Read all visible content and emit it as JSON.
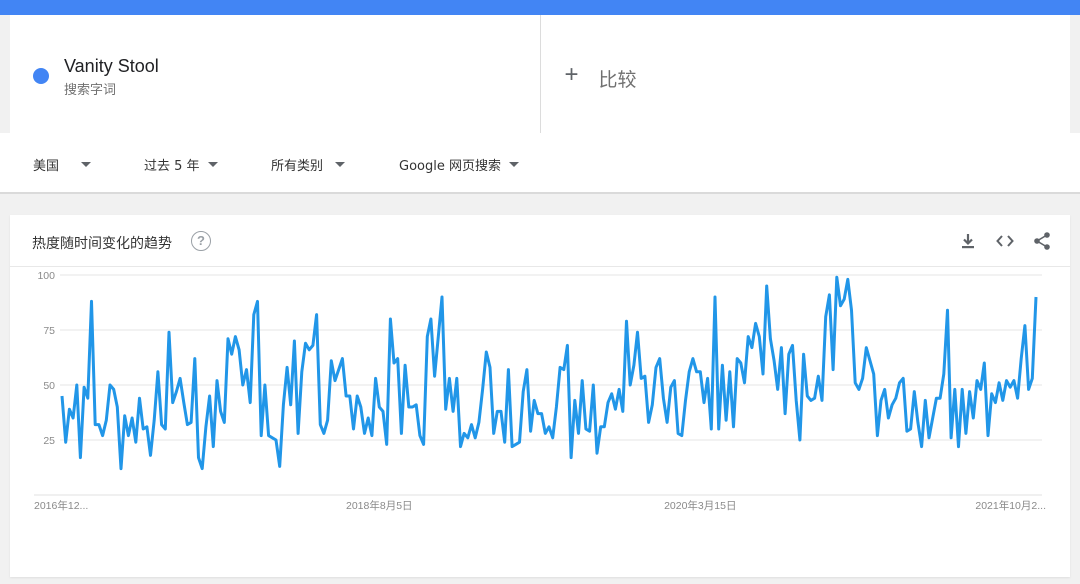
{
  "colors": {
    "accent": "#4285f4",
    "series": "#2196e8"
  },
  "term": {
    "name": "Vanity Stool",
    "sub": "搜索字词",
    "dot_icon": "circle-dot"
  },
  "compare": {
    "label": "比较",
    "icon": "plus-icon"
  },
  "filters": [
    {
      "label": "美国"
    },
    {
      "label": "过去 5 年"
    },
    {
      "label": "所有类别"
    },
    {
      "label": "Google 网页搜索"
    }
  ],
  "chart_header": {
    "title": "热度随时间变化的趋势",
    "help": "?",
    "icons": [
      "download-icon",
      "embed-code-icon",
      "share-icon"
    ]
  },
  "chart_data": {
    "type": "line",
    "title": "",
    "xlabel": "",
    "ylabel": "",
    "ylim": [
      0,
      100
    ],
    "yticks": [
      25,
      50,
      75,
      100
    ],
    "grid": true,
    "x_tick_labels": [
      "2016年12...",
      "2018年8月5日",
      "2020年3月15日",
      "2021年10月2..."
    ],
    "x_tick_index": [
      0,
      86,
      173,
      263
    ],
    "partial_from_index": 265,
    "series": [
      {
        "values": [
          45,
          24,
          39,
          35,
          50,
          17,
          49,
          44,
          88,
          32,
          32,
          27,
          34,
          50,
          48,
          40,
          12,
          36,
          27,
          35,
          24,
          44,
          30,
          31,
          18,
          34,
          56,
          32,
          30,
          74,
          42,
          47,
          53,
          42,
          32,
          33,
          62,
          17,
          12,
          31,
          45,
          22,
          52,
          38,
          33,
          71,
          64,
          72,
          66,
          50,
          57,
          42,
          82,
          88,
          27,
          50,
          27,
          26,
          25,
          13,
          41,
          58,
          41,
          70,
          28,
          56,
          69,
          66,
          68,
          82,
          32,
          28,
          34,
          61,
          52,
          57,
          62,
          45,
          45,
          30,
          45,
          40,
          28,
          35,
          27,
          53,
          40,
          38,
          23,
          80,
          60,
          62,
          28,
          59,
          40,
          40,
          41,
          27,
          23,
          72,
          80,
          54,
          72,
          90,
          39,
          53,
          38,
          53,
          22,
          28,
          26,
          32,
          26,
          33,
          48,
          65,
          58,
          28,
          38,
          38,
          24,
          57,
          22,
          23,
          24,
          47,
          57,
          29,
          43,
          37,
          37,
          28,
          31,
          26,
          40,
          58,
          57,
          68,
          17,
          43,
          28,
          52,
          30,
          29,
          50,
          19,
          31,
          31,
          42,
          46,
          39,
          48,
          38,
          79,
          50,
          59,
          74,
          53,
          54,
          33,
          41,
          58,
          62,
          44,
          33,
          49,
          52,
          28,
          27,
          43,
          56,
          62,
          56,
          56,
          42,
          53,
          30,
          90,
          30,
          59,
          34,
          56,
          31,
          62,
          60,
          51,
          72,
          67,
          78,
          72,
          55,
          95,
          71,
          61,
          48,
          67,
          37,
          64,
          68,
          43,
          25,
          64,
          45,
          43,
          44,
          54,
          43,
          81,
          91,
          57,
          99,
          86,
          89,
          98,
          84,
          51,
          48,
          53,
          67,
          61,
          55,
          27,
          43,
          48,
          35,
          41,
          44,
          51,
          53,
          29,
          30,
          47,
          33,
          22,
          43,
          26,
          35,
          44,
          44,
          55,
          84,
          26,
          48,
          22,
          48,
          28,
          47,
          35,
          52,
          48,
          60,
          27,
          46,
          42,
          51,
          43,
          52,
          49,
          52,
          44,
          62,
          77,
          48,
          53,
          90
        ]
      }
    ]
  }
}
